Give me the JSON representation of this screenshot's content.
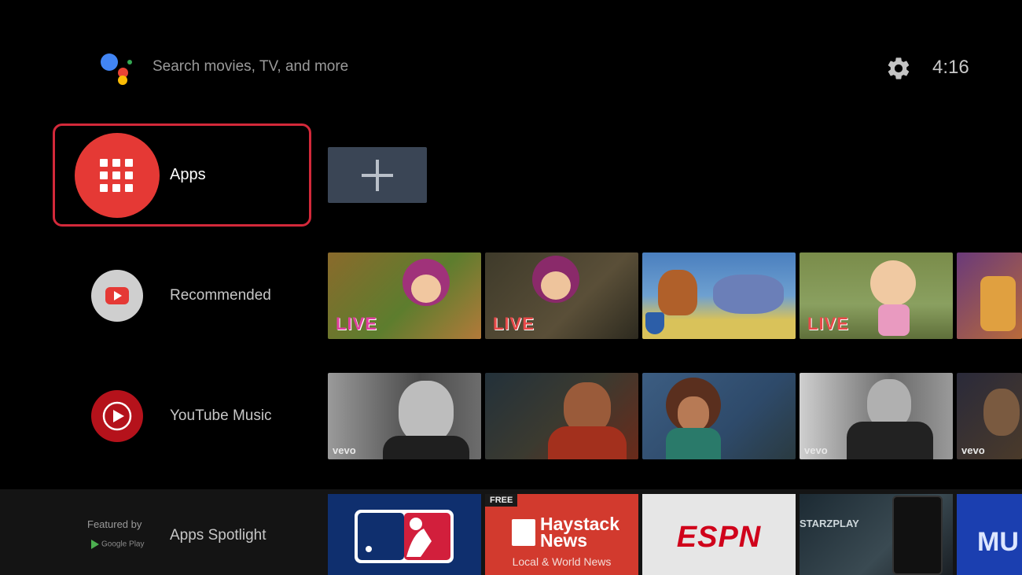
{
  "header": {
    "search_placeholder": "Search movies, TV, and more",
    "time": "4:16",
    "icons": [
      "google-assistant-icon",
      "gear-icon"
    ]
  },
  "apps_row": {
    "label": "Apps",
    "add_tile_icon": "plus-icon"
  },
  "rows": [
    {
      "label": "Recommended",
      "icon": "youtube-icon",
      "tiles": [
        {
          "badge": "LIVE"
        },
        {
          "badge": "LIVE"
        },
        {
          "badge": ""
        },
        {
          "badge": "LIVE"
        },
        {
          "badge": ""
        }
      ]
    },
    {
      "label": "YouTube Music",
      "icon": "youtube-music-icon",
      "tiles": [
        {
          "badge": "vevo"
        },
        {
          "badge": ""
        },
        {
          "badge": ""
        },
        {
          "badge": "vevo"
        },
        {
          "badge": "vevo"
        }
      ]
    }
  ],
  "spotlight": {
    "featured_by": "Featured by",
    "google_play": "Google Play",
    "label": "Apps Spotlight",
    "tiles": [
      {
        "name": "MLB",
        "text": ""
      },
      {
        "name": "Haystack News",
        "badge": "FREE",
        "title": "Haystack News",
        "subtitle": "Local & World News"
      },
      {
        "name": "ESPN",
        "text": "ESPN"
      },
      {
        "name": "STARZPLAY",
        "text": "STARZPLAY"
      },
      {
        "name": "MU",
        "text": "MU"
      }
    ]
  },
  "colors": {
    "focus_border": "#d3293a",
    "apps_circle": "#e53935",
    "add_tile": "#3a4555"
  }
}
